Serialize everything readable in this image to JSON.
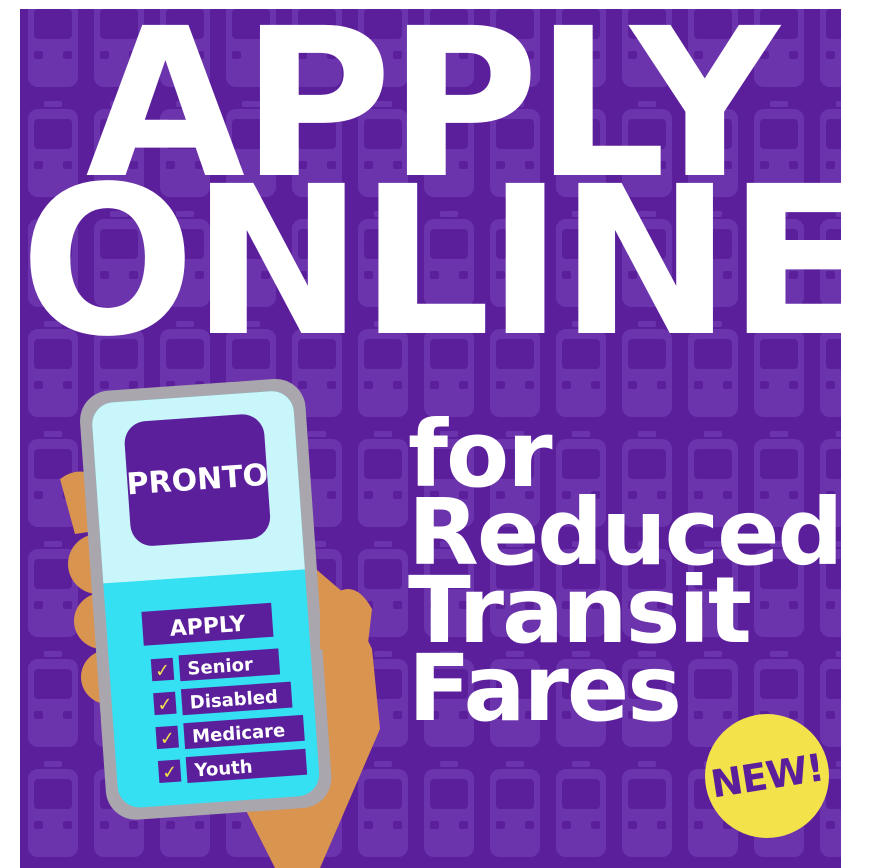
{
  "headline": {
    "line1": "APPLY",
    "line2": "ONLINE"
  },
  "subheadline": {
    "line1": "for",
    "line2": "Reduced",
    "line3": "Transit",
    "line4": "Fares"
  },
  "badge": {
    "label": "NEW!"
  },
  "phone": {
    "app_name": "PRONTO",
    "apply_label": "APPLY",
    "categories": [
      "Senior",
      "Disabled",
      "Medicare",
      "Youth"
    ]
  },
  "colors": {
    "background_purple": "#5b1f9c",
    "pattern_purple": "#6b34ad",
    "text_white": "#ffffff",
    "badge_yellow": "#f4e24b",
    "screen_cyan": "#35e0f2",
    "screen_pale": "#c8f6fb",
    "hand_tan": "#d9944f",
    "phone_gray": "#a9a6ae"
  }
}
